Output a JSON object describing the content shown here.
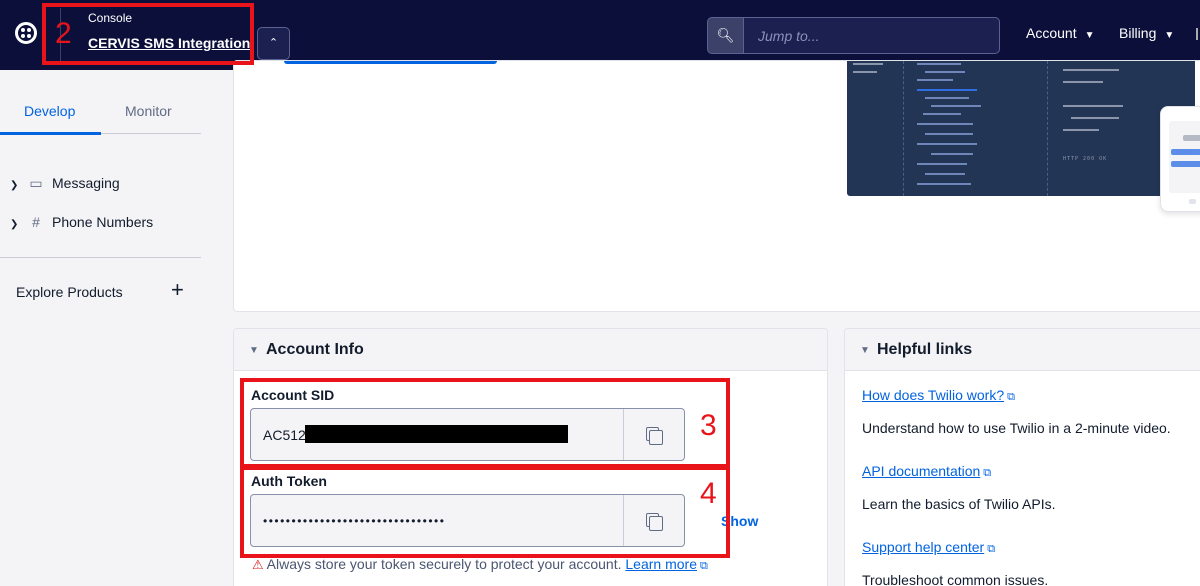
{
  "topbar": {
    "console_label": "Console",
    "account_name": "CERVIS SMS Integration",
    "search_placeholder": "Jump to...",
    "menus": [
      {
        "label": "Account"
      },
      {
        "label": "Billing"
      }
    ]
  },
  "sidebar": {
    "tabs": [
      {
        "label": "Develop",
        "active": true
      },
      {
        "label": "Monitor",
        "active": false
      }
    ],
    "items": [
      {
        "label": "Messaging",
        "icon": "message-icon"
      },
      {
        "label": "Phone Numbers",
        "icon": "hash-icon"
      }
    ],
    "explore_label": "Explore Products"
  },
  "account_info": {
    "title": "Account Info",
    "sid_label": "Account SID",
    "sid_value": "AC512",
    "token_label": "Auth Token",
    "token_value": "••••••••••••••••••••••••••••••••",
    "show_label": "Show",
    "warning_text": "Always store your token securely to protect your account.",
    "learn_more": "Learn more"
  },
  "helpful_links": {
    "title": "Helpful links",
    "items": [
      {
        "link": "How does Twilio work?",
        "text": "Understand how to use Twilio in a 2-minute video."
      },
      {
        "link": "API documentation",
        "text": "Learn the basics of Twilio APIs."
      },
      {
        "link": "Support help center",
        "text": "Troubleshoot common issues."
      }
    ]
  },
  "illustration": {
    "status_text": "HTTP 200 OK"
  },
  "annotations": [
    {
      "number": "2"
    },
    {
      "number": "3"
    },
    {
      "number": "4"
    }
  ],
  "colors": {
    "topbar_bg": "#0b0f3a",
    "accent": "#0263e0",
    "annotation_red": "#e8141a"
  }
}
